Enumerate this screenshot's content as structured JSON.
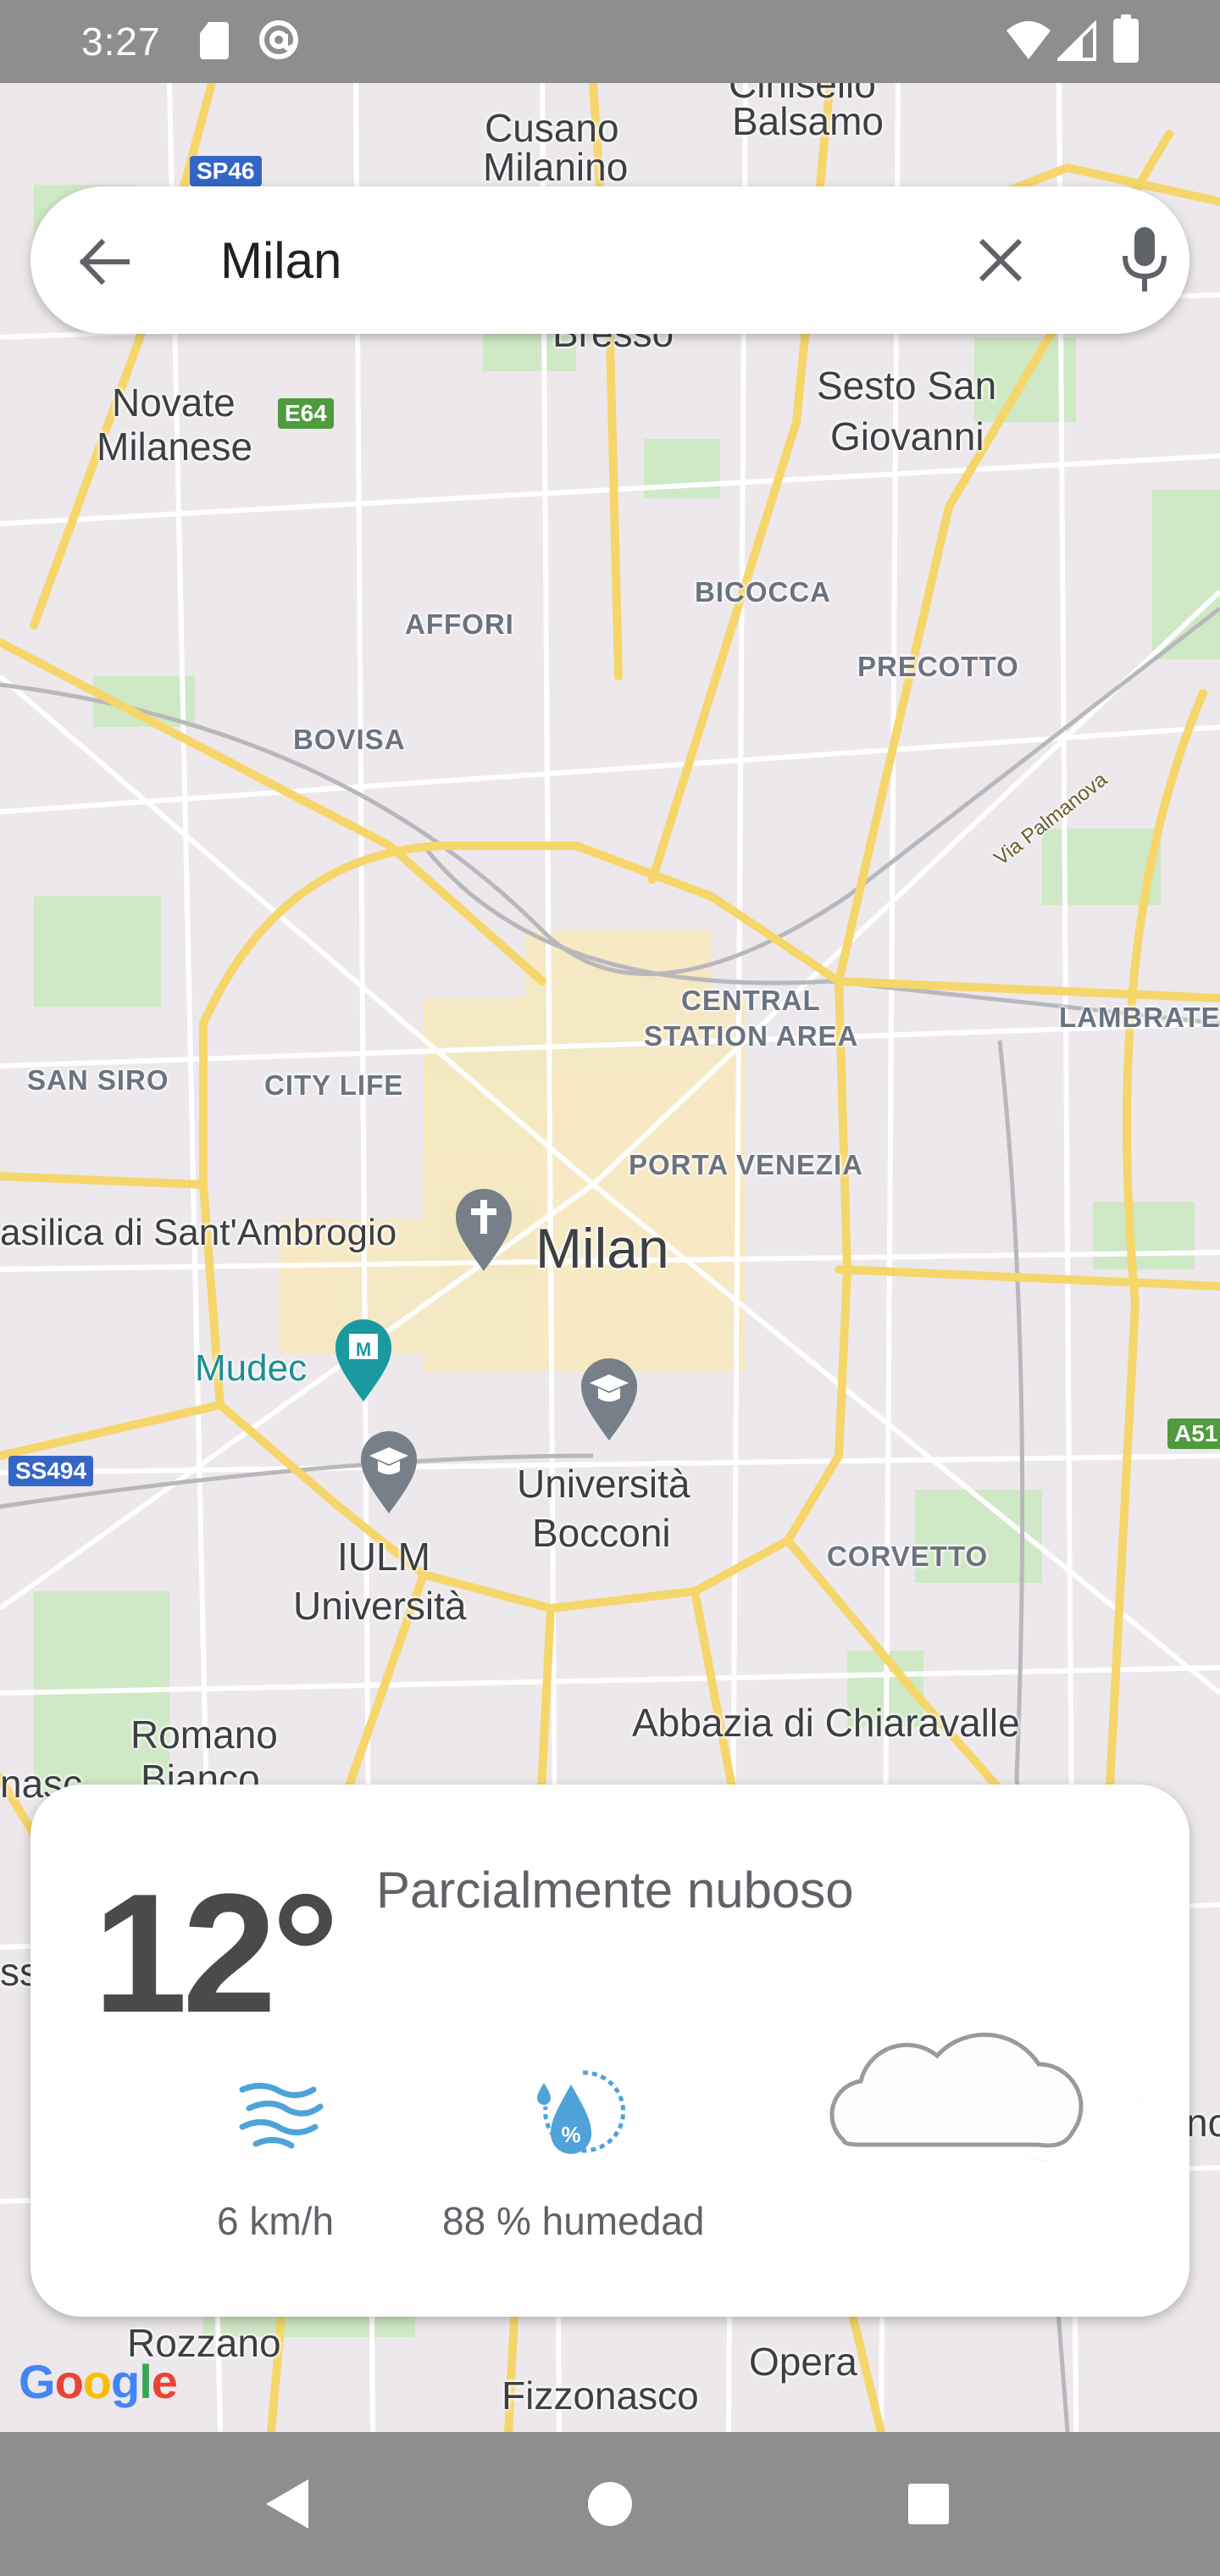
{
  "status_bar": {
    "time": "3:27",
    "icons": [
      "sd-card-icon",
      "at-sign-icon",
      "wifi-icon",
      "signal-icon",
      "battery-icon"
    ]
  },
  "search": {
    "query": "Milan",
    "icons": [
      "back-arrow-icon",
      "clear-icon",
      "microphone-icon"
    ]
  },
  "map": {
    "labels": {
      "cinisello": "Cinisello",
      "balsamo": "Balsamo",
      "cusano": "Cusano",
      "milanino": "Milanino",
      "bresso": "Bresso",
      "novate": "Novate",
      "milanese": "Milanese",
      "sesto_san": "Sesto San",
      "giovanni": "Giovanni",
      "bicocca": "BICOCCA",
      "affori": "AFFORI",
      "precotto": "PRECOTTO",
      "bovisa": "BOVISA",
      "via_palmanova": "Via Palmanova",
      "central1": "CENTRAL",
      "central2": "STATION AREA",
      "lambrate": "LAMBRATE",
      "san_siro": "SAN SIRO",
      "city_life": "CITY LIFE",
      "porta_venezia": "PORTA VENEZIA",
      "basilica": "asilica di Sant'Ambrogio",
      "milan": "Milan",
      "mudec": "Mudec",
      "universita1": "Università",
      "universita2": "Bocconi",
      "iulm1": "IULM",
      "iulm2": "Università",
      "corvetto": "CORVETTO",
      "romano": "Romano",
      "bianco": "Bianco",
      "abbazia": "Abbazia di Chiaravalle",
      "rozzano": "Rozzano",
      "opera": "Opera",
      "fizzonasco": "Fizzonasco",
      "nasco_left": "nasc",
      "ss_left": "ss",
      "no_right": "no"
    },
    "shields": {
      "sp46": "SP46",
      "e64": "E64",
      "ss494": "SS494",
      "a51": "A51"
    },
    "google_logo": "Google"
  },
  "weather": {
    "temperature": "12°",
    "condition": "Parcialmente nuboso",
    "wind": "6 km/h",
    "humidity": "88 % humedad"
  },
  "nav_bar": {
    "icons": [
      "back-triangle-icon",
      "home-circle-icon",
      "recents-square-icon"
    ]
  }
}
